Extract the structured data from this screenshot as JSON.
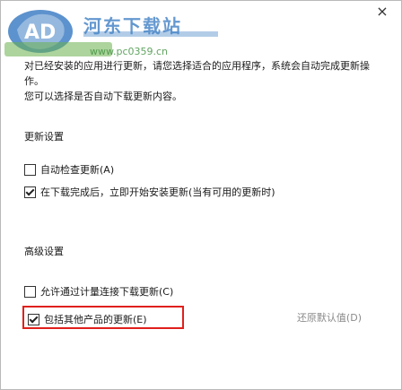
{
  "dialog": {
    "close_label": "×",
    "watermark_title": "河东下载站",
    "watermark_sub": "www.pc0359.cn"
  },
  "intro": {
    "line1": "对已经安装的应用进行更新，请您选择适合的应用程序，系统会自动完成更新操作。",
    "line2": "您可以选择是否自动下载更新内容。"
  },
  "section1": {
    "title": "更新设置",
    "option1": "自动检查更新(A)",
    "option2": "在下载完成后，立即开始安装更新(当有可用的更新时)"
  },
  "section2": {
    "title": "高级设置",
    "option1": "允许通过计量连接下载更新(C)",
    "option2": "包括其他产品的更新(E)"
  },
  "restore_label": "还原默认值(D)",
  "state": {
    "s1_opt1_checked": false,
    "s1_opt2_checked": true,
    "s2_opt1_checked": false,
    "s2_opt2_checked": true
  },
  "colors": {
    "highlight": "#e0201c",
    "link_disabled": "#8a8a8a"
  }
}
